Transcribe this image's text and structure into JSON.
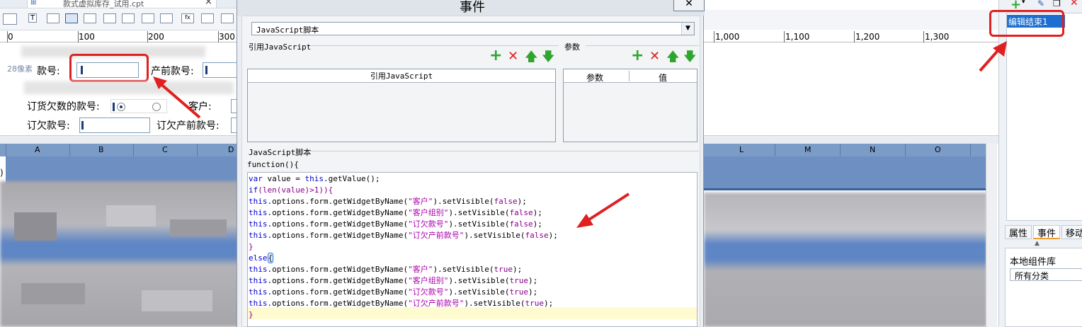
{
  "editor_tab": {
    "title": "款式虚拟库存_试用.cpt",
    "close": "×"
  },
  "toolbar_icons": [
    "form-new-icon",
    "text-icon",
    "label-icon",
    "box-icon",
    "combo-icon",
    "list-icon",
    "date-icon",
    "number-icon",
    "checkbox-icon",
    "formula-icon",
    "image-icon",
    "frame-icon"
  ],
  "ruler_left": [
    "0",
    "100",
    "200",
    "300"
  ],
  "ruler_right": [
    "1,000",
    "1,100",
    "1,200",
    "1,300"
  ],
  "form": {
    "pixel_hint": "28像素",
    "field1_label": "款号:",
    "field2_label": "产前款号:",
    "field3_label": "订货欠数的款号:",
    "field4_label": "客户:",
    "field5_label": "订欠款号:",
    "field6_label": "订欠产前款号:"
  },
  "sheet_cols_left": [
    "A",
    "B",
    "C",
    "D"
  ],
  "sheet_cols_right": [
    "L",
    "M",
    "N",
    "O"
  ],
  "sheet_row": ")",
  "dialog": {
    "title": "事件",
    "close": "✕",
    "event_type": "JavaScript脚本",
    "ref_js_group": "引用JavaScript",
    "params_group": "参数",
    "ref_js_header": "引用JavaScript",
    "param_header": "参数",
    "value_header": "值",
    "script_group": "JavaScript脚本",
    "function_open": "function(){",
    "code": [
      [
        {
          "t": "var",
          "c": "kw"
        },
        {
          "t": " value = ",
          "c": "n"
        },
        {
          "t": "this",
          "c": "kw"
        },
        {
          "t": ".getValue();",
          "c": "n"
        }
      ],
      [
        {
          "t": "if",
          "c": "kw"
        },
        {
          "t": "(len(value)>1)){",
          "c": "p"
        }
      ],
      [
        {
          "t": "this",
          "c": "kw"
        },
        {
          "t": ".options.form.getWidgetByName(",
          "c": "n"
        },
        {
          "t": "\"客户\"",
          "c": "s"
        },
        {
          "t": ").setVisible(",
          "c": "n"
        },
        {
          "t": "false",
          "c": "p"
        },
        {
          "t": ");",
          "c": "n"
        }
      ],
      [
        {
          "t": "this",
          "c": "kw"
        },
        {
          "t": ".options.form.getWidgetByName(",
          "c": "n"
        },
        {
          "t": "\"客户组别\"",
          "c": "s"
        },
        {
          "t": ").setVisible(",
          "c": "n"
        },
        {
          "t": "false",
          "c": "p"
        },
        {
          "t": ");",
          "c": "n"
        }
      ],
      [
        {
          "t": "this",
          "c": "kw"
        },
        {
          "t": ".options.form.getWidgetByName(",
          "c": "n"
        },
        {
          "t": "\"订欠款号\"",
          "c": "s"
        },
        {
          "t": ").setVisible(",
          "c": "n"
        },
        {
          "t": "false",
          "c": "p"
        },
        {
          "t": ");",
          "c": "n"
        }
      ],
      [
        {
          "t": "this",
          "c": "kw"
        },
        {
          "t": ".options.form.getWidgetByName(",
          "c": "n"
        },
        {
          "t": "\"订欠产前款号\"",
          "c": "s"
        },
        {
          "t": ").setVisible(",
          "c": "n"
        },
        {
          "t": "false",
          "c": "p"
        },
        {
          "t": ");",
          "c": "n"
        }
      ],
      [
        {
          "t": "}",
          "c": "p"
        }
      ],
      [
        {
          "t": "else",
          "c": "kw"
        },
        {
          "t": "{",
          "c": "b"
        }
      ],
      [
        {
          "t": "this",
          "c": "kw"
        },
        {
          "t": ".options.form.getWidgetByName(",
          "c": "n"
        },
        {
          "t": "\"客户\"",
          "c": "s"
        },
        {
          "t": ").setVisible(",
          "c": "n"
        },
        {
          "t": "true",
          "c": "p"
        },
        {
          "t": ");",
          "c": "n"
        }
      ],
      [
        {
          "t": "this",
          "c": "kw"
        },
        {
          "t": ".options.form.getWidgetByName(",
          "c": "n"
        },
        {
          "t": "\"客户组别\"",
          "c": "s"
        },
        {
          "t": ").setVisible(",
          "c": "n"
        },
        {
          "t": "true",
          "c": "p"
        },
        {
          "t": ");",
          "c": "n"
        }
      ],
      [
        {
          "t": "this",
          "c": "kw"
        },
        {
          "t": ".options.form.getWidgetByName(",
          "c": "n"
        },
        {
          "t": "\"订欠款号\"",
          "c": "s"
        },
        {
          "t": ").setVisible(",
          "c": "n"
        },
        {
          "t": "true",
          "c": "p"
        },
        {
          "t": ");",
          "c": "n"
        }
      ],
      [
        {
          "t": "this",
          "c": "kw"
        },
        {
          "t": ".options.form.getWidgetByName(",
          "c": "n"
        },
        {
          "t": "\"订欠产前款号\"",
          "c": "s"
        },
        {
          "t": ").setVisible(",
          "c": "n"
        },
        {
          "t": "true",
          "c": "p"
        },
        {
          "t": ");",
          "c": "n"
        }
      ],
      [
        {
          "t": "}",
          "c": "p"
        }
      ]
    ]
  },
  "right_panel": {
    "selected_event": "编辑结束1",
    "tabs": [
      "属性",
      "事件",
      "移动"
    ],
    "active_tab": "事件",
    "library_label": "本地组件库",
    "category": "所有分类"
  },
  "colors": {
    "accent_red": "#e02020",
    "selection_blue": "#1c6fd0",
    "keyword": "#0000cc",
    "string": "#aa00aa",
    "paren": "#880088",
    "add_green": "#2fa52f"
  }
}
